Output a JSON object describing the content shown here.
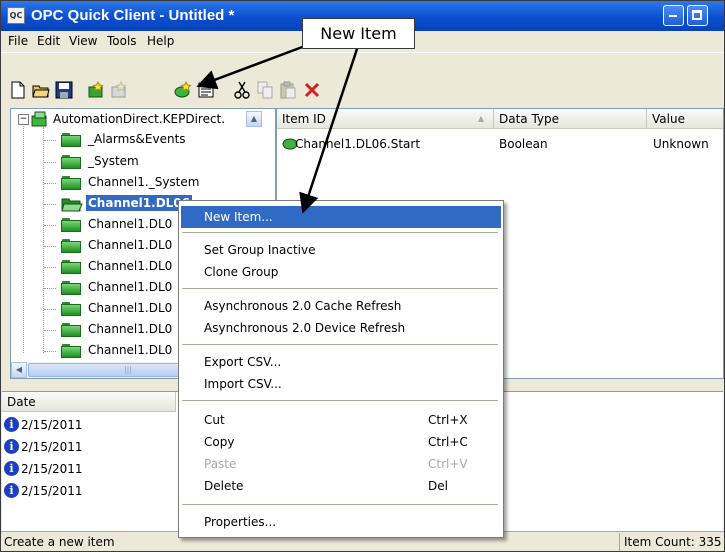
{
  "window": {
    "app_icon_text": "QC",
    "title": "OPC Quick Client - Untitled *"
  },
  "menu": [
    "File",
    "Edit",
    "View",
    "Tools",
    "Help"
  ],
  "toolbar_icons": [
    "new-document-icon",
    "open-folder-icon",
    "save-icon",
    "new-server-connection-icon",
    "new-group-icon",
    "new-item-icon",
    "properties-icon",
    "cut-icon",
    "copy-icon",
    "paste-icon",
    "delete-icon"
  ],
  "tree": {
    "root": "AutomationDirect.KEPDirect.",
    "children": [
      "_Alarms&Events",
      "_System",
      "Channel1._System",
      "Channel1.DL06",
      "Channel1.DL0",
      "Channel1.DL0",
      "Channel1.DL0",
      "Channel1.DL0",
      "Channel1.DL0",
      "Channel1.DL0",
      "Channel1.DL0"
    ],
    "selected": "Channel1.DL06"
  },
  "items_table": {
    "columns": [
      "Item ID",
      "Data Type",
      "Value"
    ],
    "rows": [
      {
        "item_id": "Channel1.DL06.Start",
        "data_type": "Boolean",
        "value": "Unknown"
      }
    ]
  },
  "log": {
    "column": "Date",
    "rows": [
      "2/15/2011",
      "2/15/2011",
      "2/15/2011",
      "2/15/2011"
    ]
  },
  "context_menu": [
    {
      "label": "New Item...",
      "shortcut": "",
      "highlighted": true
    },
    {
      "label": "Set Group Inactive",
      "shortcut": ""
    },
    {
      "label": "Clone Group",
      "shortcut": ""
    },
    {
      "label": "Asynchronous 2.0 Cache Refresh",
      "shortcut": ""
    },
    {
      "label": "Asynchronous 2.0 Device Refresh",
      "shortcut": ""
    },
    {
      "label": "Export CSV...",
      "shortcut": ""
    },
    {
      "label": "Import CSV...",
      "shortcut": ""
    },
    {
      "label": "Cut",
      "shortcut": "Ctrl+X"
    },
    {
      "label": "Copy",
      "shortcut": "Ctrl+C"
    },
    {
      "label": "Paste",
      "shortcut": "Ctrl+V",
      "disabled": true
    },
    {
      "label": "Delete",
      "shortcut": "Del"
    },
    {
      "label": "Properties...",
      "shortcut": ""
    }
  ],
  "status": {
    "left": "Create a new item",
    "right": "Item Count: 335"
  },
  "callout": "New Item",
  "colors": {
    "titlebar": "#0a4fd0",
    "highlight": "#316ac5",
    "folder": "#1f8f1f"
  }
}
